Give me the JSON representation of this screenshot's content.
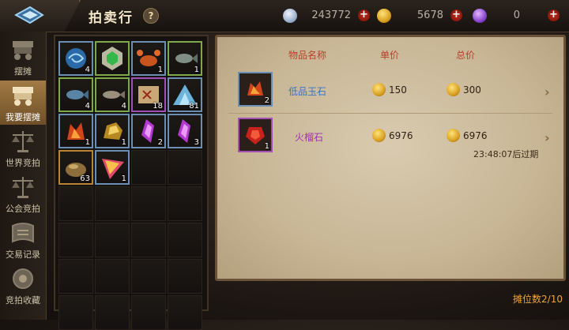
{
  "header": {
    "title": "拍卖行",
    "help": "?"
  },
  "currency": [
    {
      "name": "silver",
      "icon": "silver-coin-icon",
      "value": "243772",
      "color": "#b9c8e0"
    },
    {
      "name": "gold",
      "icon": "gold-coin-icon",
      "value": "5678",
      "color": "#f0b72a"
    },
    {
      "name": "gem",
      "icon": "purple-gem-icon",
      "value": "0",
      "color": "#9a5ad8"
    }
  ],
  "sidebar": {
    "items": [
      {
        "label": "摆摊",
        "icon": "cart-icon",
        "active": false
      },
      {
        "label": "我要摆摊",
        "icon": "stall-cart-icon",
        "active": true
      },
      {
        "label": "世界竞拍",
        "icon": "scale-icon",
        "active": false
      },
      {
        "label": "公会竞拍",
        "icon": "guild-scale-icon",
        "active": false
      },
      {
        "label": "交易记录",
        "icon": "record-icon",
        "active": false
      },
      {
        "label": "竞拍收藏",
        "icon": "collection-icon",
        "active": false
      }
    ]
  },
  "inventory": {
    "items": [
      {
        "icon": "whirlpool-icon",
        "count": "4",
        "rarity": "blue"
      },
      {
        "icon": "green-gem-badge-icon",
        "count": "",
        "rarity": "green"
      },
      {
        "icon": "crab-icon",
        "count": "1",
        "rarity": "blue"
      },
      {
        "icon": "fish-icon",
        "count": "1",
        "rarity": "green"
      },
      {
        "icon": "blue-fish-icon",
        "count": "4",
        "rarity": "green"
      },
      {
        "icon": "grey-fish-icon",
        "count": "4",
        "rarity": "green"
      },
      {
        "icon": "treasure-map-icon",
        "count": "18",
        "rarity": "purple"
      },
      {
        "icon": "crystal-pile-icon",
        "count": "81",
        "rarity": "blue"
      },
      {
        "icon": "fire-jade-icon",
        "count": "1",
        "rarity": "blue"
      },
      {
        "icon": "gold-ore-icon",
        "count": "1",
        "rarity": "blue"
      },
      {
        "icon": "purple-crystal-icon",
        "count": "2",
        "rarity": "blue"
      },
      {
        "icon": "purple-crystal-icon",
        "count": "3",
        "rarity": "blue"
      },
      {
        "icon": "seed-icon",
        "count": "63",
        "rarity": "orange"
      },
      {
        "icon": "pink-shard-icon",
        "count": "1",
        "rarity": "blue"
      }
    ]
  },
  "board": {
    "headers": {
      "name": "物品名称",
      "unit": "单价",
      "total": "总价"
    },
    "rows": [
      {
        "icon": "fire-jade-icon",
        "count": "2",
        "name": "低品玉石",
        "name_color": "#3a74c4",
        "unit": "150",
        "total": "300",
        "expire": ""
      },
      {
        "icon": "fire-stone-icon",
        "count": "1",
        "name": "火榴石",
        "name_color": "#a230b4",
        "unit": "6976",
        "total": "6976",
        "expire": "23:48:07后过期"
      }
    ]
  },
  "footer": {
    "stall_count": "摊位数2/10"
  }
}
